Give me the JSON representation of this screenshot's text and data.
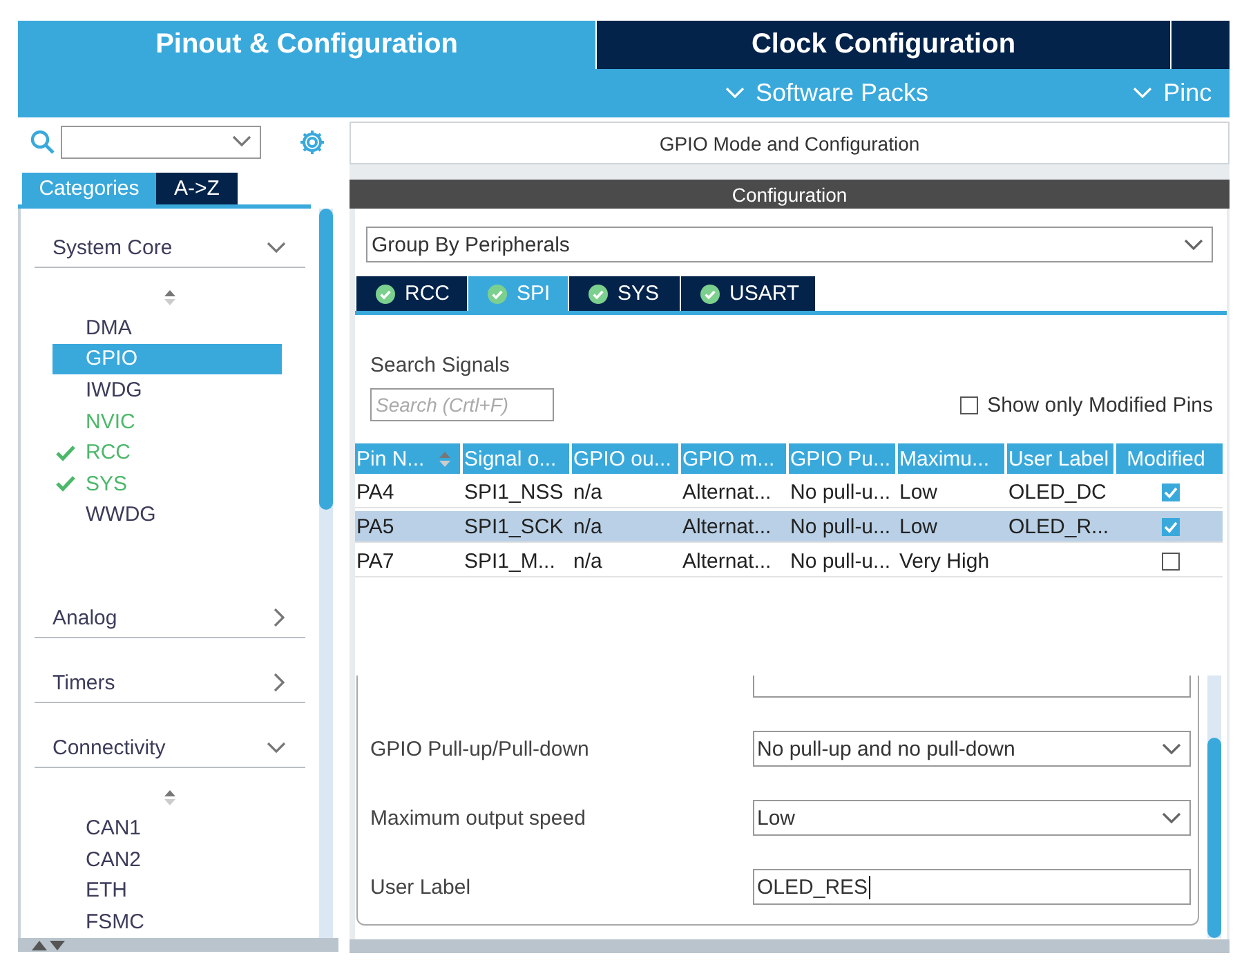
{
  "main_tabs": [
    {
      "label": "Pinout & Configuration",
      "selected": true
    },
    {
      "label": "Clock Configuration",
      "selected": false
    }
  ],
  "sub_menu": [
    {
      "label": "Software Packs"
    },
    {
      "label": "Pinc"
    }
  ],
  "sidebar": {
    "tabs": [
      {
        "label": "Categories",
        "selected": true
      },
      {
        "label": "A->Z",
        "selected": false
      }
    ],
    "categories": [
      {
        "label": "System Core",
        "expanded": true,
        "items": [
          {
            "label": "DMA",
            "configured": false,
            "selected": false,
            "checked": false
          },
          {
            "label": "GPIO",
            "selected": true,
            "checked": false
          },
          {
            "label": "IWDG",
            "configured": false,
            "selected": false,
            "checked": false
          },
          {
            "label": "NVIC",
            "configured": true,
            "selected": false,
            "checked": false
          },
          {
            "label": "RCC",
            "configured": true,
            "selected": false,
            "checked": true
          },
          {
            "label": "SYS",
            "configured": true,
            "selected": false,
            "checked": true
          },
          {
            "label": "WWDG",
            "configured": false,
            "selected": false,
            "checked": false
          }
        ]
      },
      {
        "label": "Analog",
        "expanded": false
      },
      {
        "label": "Timers",
        "expanded": false
      },
      {
        "label": "Connectivity",
        "expanded": true,
        "items": [
          {
            "label": "CAN1",
            "configured": false,
            "selected": false,
            "checked": false
          },
          {
            "label": "CAN2",
            "configured": false,
            "selected": false,
            "checked": false
          },
          {
            "label": "ETH",
            "configured": false,
            "selected": false,
            "checked": false
          },
          {
            "label": "FSMC",
            "configured": false,
            "selected": false,
            "checked": false
          }
        ]
      }
    ]
  },
  "gpio_panel": {
    "title": "GPIO Mode and Configuration",
    "section": "Configuration",
    "group_by": "Group By Peripherals",
    "tabs": [
      {
        "label": "RCC",
        "selected": false
      },
      {
        "label": "SPI",
        "selected": true
      },
      {
        "label": "SYS",
        "selected": false
      },
      {
        "label": "USART",
        "selected": false
      }
    ],
    "search": {
      "label": "Search Signals",
      "placeholder": "Search (Crtl+F)"
    },
    "modified_filter": {
      "label": "Show only Modified Pins",
      "checked": false
    },
    "table": {
      "columns": [
        {
          "label": "Pin N...",
          "sorted": true
        },
        {
          "label": "Signal o...",
          "sorted": false
        },
        {
          "label": "GPIO ou...",
          "sorted": false
        },
        {
          "label": "GPIO m...",
          "sorted": false
        },
        {
          "label": "GPIO Pu...",
          "sorted": false
        },
        {
          "label": "Maximu...",
          "sorted": false
        },
        {
          "label": "User Label",
          "sorted": false
        },
        {
          "label": "Modified",
          "sorted": false
        }
      ],
      "rows": [
        {
          "cells": [
            "PA4",
            "SPI1_NSS",
            "n/a",
            "Alternat...",
            "No pull-u...",
            "Low",
            "OLED_DC"
          ],
          "modified": true,
          "selected": false
        },
        {
          "cells": [
            "PA5",
            "SPI1_SCK",
            "n/a",
            "Alternat...",
            "No pull-u...",
            "Low",
            "OLED_R..."
          ],
          "modified": true,
          "selected": true
        },
        {
          "cells": [
            "PA7",
            "SPI1_M...",
            "n/a",
            "Alternat...",
            "No pull-u...",
            "Very High",
            ""
          ],
          "modified": false,
          "selected": false
        }
      ]
    },
    "properties": [
      {
        "label": "GPIO Pull-up/Pull-down",
        "kind": "dropdown",
        "value": "No pull-up and no pull-down"
      },
      {
        "label": "Maximum output speed",
        "kind": "dropdown",
        "value": "Low"
      },
      {
        "label": "User Label",
        "kind": "text",
        "value": "OLED_RES"
      }
    ]
  }
}
